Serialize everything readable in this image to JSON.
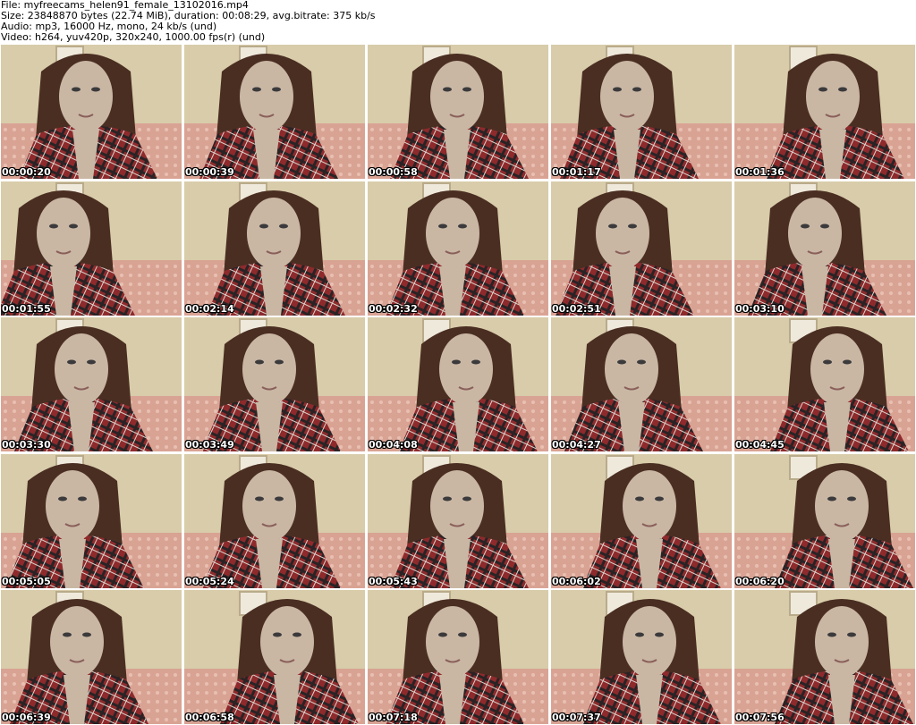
{
  "header": {
    "file_line": "File: myfreecams_helen91_female_13102016.mp4",
    "size_line": "Size: 23848870 bytes (22.74 MiB), duration: 00:08:29, avg.bitrate: 375 kb/s",
    "audio_line": "Audio: mp3, 16000 Hz, mono, 24 kb/s (und)",
    "video_line": "Video: h264, yuv420p, 320x240, 1000.00 fps(r) (und)"
  },
  "thumbnails": [
    {
      "timestamp": "00:00:20"
    },
    {
      "timestamp": "00:00:39"
    },
    {
      "timestamp": "00:00:58"
    },
    {
      "timestamp": "00:01:17"
    },
    {
      "timestamp": "00:01:36"
    },
    {
      "timestamp": "00:01:55"
    },
    {
      "timestamp": "00:02:14"
    },
    {
      "timestamp": "00:02:32"
    },
    {
      "timestamp": "00:02:51"
    },
    {
      "timestamp": "00:03:10"
    },
    {
      "timestamp": "00:03:30"
    },
    {
      "timestamp": "00:03:49"
    },
    {
      "timestamp": "00:04:08"
    },
    {
      "timestamp": "00:04:27"
    },
    {
      "timestamp": "00:04:45"
    },
    {
      "timestamp": "00:05:05"
    },
    {
      "timestamp": "00:05:24"
    },
    {
      "timestamp": "00:05:43"
    },
    {
      "timestamp": "00:06:02"
    },
    {
      "timestamp": "00:06:20"
    },
    {
      "timestamp": "00:06:39"
    },
    {
      "timestamp": "00:06:58"
    },
    {
      "timestamp": "00:07:18"
    },
    {
      "timestamp": "00:07:37"
    },
    {
      "timestamp": "00:07:56"
    }
  ],
  "colors": {
    "wall": "#d8ccaa",
    "sofa": "#d9a394",
    "shirt_red": "#8e2a2c",
    "shirt_dark": "#2a2325",
    "hair": "#4a2e22",
    "skin": "#c9b7a4"
  }
}
